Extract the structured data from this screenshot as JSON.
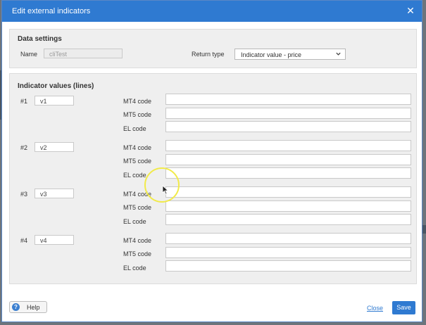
{
  "dialog": {
    "title": "Edit external indicators",
    "close_glyph": "✕"
  },
  "data_settings": {
    "title": "Data settings",
    "name_label": "Name",
    "name_value": "cliTest",
    "return_type_label": "Return type",
    "return_type_value": "Indicator value - price"
  },
  "indicators": {
    "title": "Indicator values (lines)",
    "code_labels": {
      "mt4": "MT4 code",
      "mt5": "MT5 code",
      "el": "EL code"
    },
    "rows": [
      {
        "num": "#1",
        "value": "v1",
        "mt4": "",
        "mt5": "",
        "el": ""
      },
      {
        "num": "#2",
        "value": "v2",
        "mt4": "",
        "mt5": "",
        "el": ""
      },
      {
        "num": "#3",
        "value": "v3",
        "mt4": "",
        "mt5": "",
        "el": ""
      },
      {
        "num": "#4",
        "value": "v4",
        "mt4": "",
        "mt5": "",
        "el": ""
      }
    ]
  },
  "footer": {
    "help_label": "Help",
    "help_icon_glyph": "?",
    "close_label": "Close",
    "save_label": "Save"
  },
  "icons": {
    "close": "close-icon",
    "dropdown": "chevron-down-icon",
    "help": "question-circle-icon",
    "cursor": "mouse-pointer-icon"
  },
  "colors": {
    "titlebar": "#2f7ad1",
    "panel": "#efefef",
    "save_button": "#2f7ad1",
    "cursor_highlight": "#f1ea4a"
  }
}
